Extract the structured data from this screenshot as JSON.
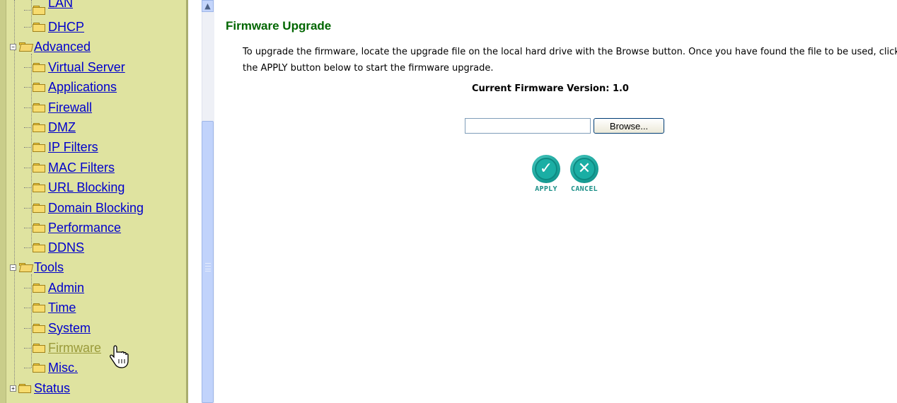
{
  "sidebar": {
    "items": [
      {
        "label": "LAN",
        "level": 1
      },
      {
        "label": "DHCP",
        "level": 1
      },
      {
        "label": "Advanced",
        "level": 0
      },
      {
        "label": "Virtual Server",
        "level": 1
      },
      {
        "label": "Applications",
        "level": 1
      },
      {
        "label": "Firewall",
        "level": 1
      },
      {
        "label": "DMZ",
        "level": 1
      },
      {
        "label": "IP Filters",
        "level": 1
      },
      {
        "label": "MAC Filters",
        "level": 1
      },
      {
        "label": "URL Blocking",
        "level": 1
      },
      {
        "label": "Domain Blocking",
        "level": 1
      },
      {
        "label": "Performance",
        "level": 1
      },
      {
        "label": "DDNS",
        "level": 1
      },
      {
        "label": "Tools",
        "level": 0
      },
      {
        "label": "Admin",
        "level": 1
      },
      {
        "label": "Time",
        "level": 1
      },
      {
        "label": "System",
        "level": 1
      },
      {
        "label": "Firmware",
        "level": 1
      },
      {
        "label": "Misc.",
        "level": 1
      },
      {
        "label": "Status",
        "level": 0
      }
    ],
    "selected": "Firmware",
    "link_color": "#0000cc",
    "visited_color": "#9a9a3a",
    "background": "#dfe3a0"
  },
  "page": {
    "title": "Firmware Upgrade",
    "description": "To upgrade the firmware, locate the upgrade file on the local hard drive with the Browse button. Once you have found the file to be used, click the APPLY button below to start the firmware upgrade.",
    "version_text": "Current Firmware Version: 1.0",
    "file_input_value": "",
    "browse_label": "Browse...",
    "apply_label": "APPLY",
    "cancel_label": "CANCEL",
    "title_color": "#006600",
    "action_color": "#1aaea4"
  }
}
